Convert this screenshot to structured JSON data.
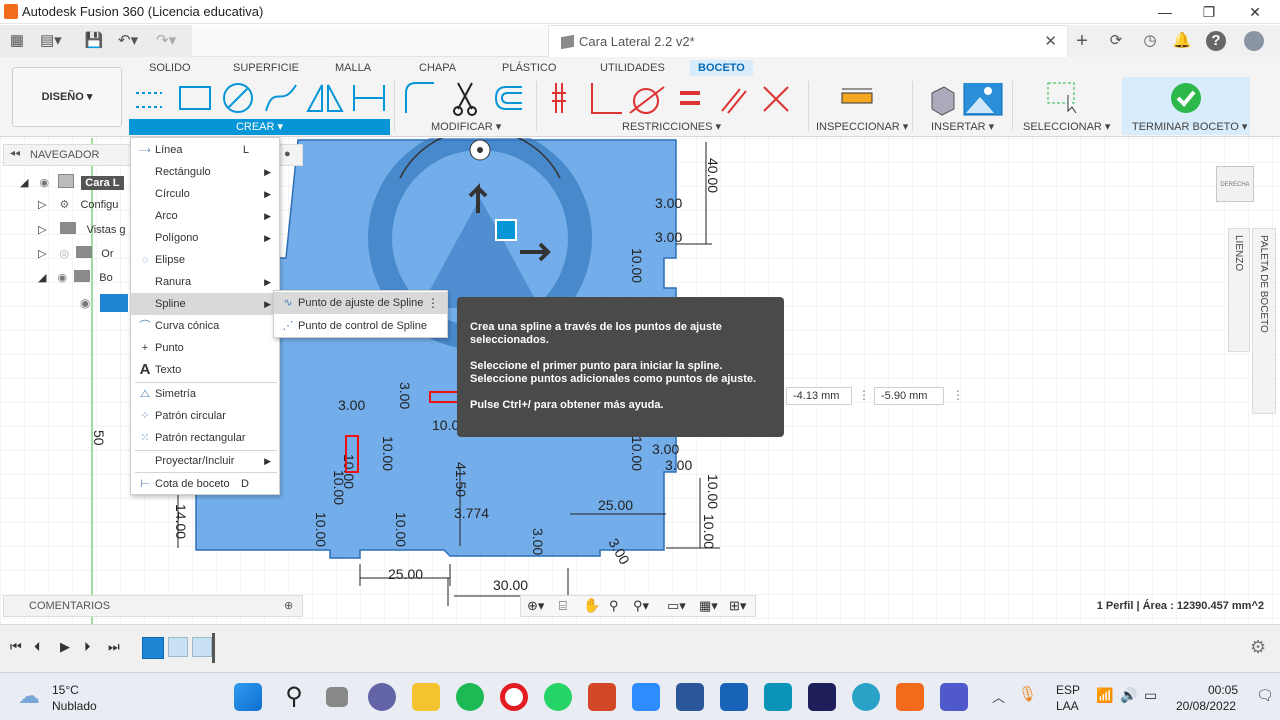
{
  "window": {
    "title": "Autodesk Fusion 360 (Licencia educativa)"
  },
  "document": {
    "tab_name": "Cara Lateral 2.2 v2*"
  },
  "ribbon": {
    "workspace": "DISEÑO",
    "tabs": [
      "SOLIDO",
      "SUPERFICIE",
      "MALLA",
      "CHAPA",
      "PLÁSTICO",
      "UTILIDADES",
      "BOCETO"
    ],
    "active_tab": "BOCETO",
    "groups": {
      "crear": "CREAR",
      "modificar": "MODIFICAR",
      "restricciones": "RESTRICCIONES",
      "inspeccionar": "INSPECCIONAR",
      "insertar": "INSERTAR",
      "seleccionar": "SELECCIONAR",
      "terminar": "TERMINAR BOCETO"
    },
    "colors": {
      "accent": "#0696d7",
      "finish_green": "#2db84b"
    }
  },
  "navigator": {
    "title": "NAVEGADOR",
    "rows": [
      "Cara L",
      "Configu",
      "Vistas g",
      "Or",
      "Bo"
    ]
  },
  "create_menu": {
    "items": [
      {
        "label": "Línea",
        "shortcut": "L",
        "icon": "line-icon"
      },
      {
        "label": "Rectángulo",
        "submenu": true,
        "icon": "rectangle-icon"
      },
      {
        "label": "Círculo",
        "submenu": true,
        "icon": "circle-icon"
      },
      {
        "label": "Arco",
        "submenu": true,
        "icon": "arc-icon"
      },
      {
        "label": "Polígono",
        "submenu": true,
        "icon": "polygon-icon"
      },
      {
        "label": "Elipse",
        "icon": "ellipse-icon"
      },
      {
        "label": "Ranura",
        "submenu": true,
        "icon": "slot-icon"
      },
      {
        "label": "Spline",
        "submenu": true,
        "icon": "spline-icon"
      },
      {
        "label": "Curva cónica",
        "icon": "conic-curve-icon"
      },
      {
        "label": "Punto",
        "icon": "point-icon"
      },
      {
        "label": "Texto",
        "icon": "text-icon"
      },
      {
        "label": "Simetría",
        "icon": "mirror-icon"
      },
      {
        "label": "Patrón circular",
        "icon": "circular-pattern-icon"
      },
      {
        "label": "Patrón rectangular",
        "icon": "rectangular-pattern-icon"
      },
      {
        "label": "Proyectar/Incluir",
        "submenu": true,
        "icon": "project-icon"
      },
      {
        "label": "Cota de boceto",
        "shortcut": "D",
        "icon": "dimension-icon"
      }
    ]
  },
  "spline_submenu": {
    "items": [
      "Punto de ajuste de Spline",
      "Punto de control de Spline"
    ]
  },
  "tooltip": {
    "line1": "Crea una spline a través de los puntos de ajuste seleccionados.",
    "line2": "Seleccione el primer punto para iniciar la spline. Seleccione puntos adicionales como puntos de ajuste.",
    "line3": "Pulse Ctrl+/ para obtener más ayuda."
  },
  "input_fields": {
    "x": "-4.13 mm",
    "y": "-5.90 mm"
  },
  "dimensions": [
    "40.00",
    "3.00",
    "3.00",
    "10.00",
    "3.00",
    "3.00",
    "10.00",
    "10.00",
    "10.00",
    "10.00",
    "10.00",
    "3.00",
    "10.00",
    "41.50",
    "3.774",
    "3.00",
    "10.00",
    "25.00",
    "10.00",
    "10.00",
    "14.00",
    "25.00",
    "30.00",
    "3.00",
    "3.00",
    "50"
  ],
  "viewcube": {
    "label": "DERECHA"
  },
  "side_panels": {
    "canvas": "LIENZO",
    "palette": "PALETA DE BOCETO"
  },
  "comments": {
    "label": "COMENTARIOS"
  },
  "status": {
    "profile": "1 Perfil | Área : 12390.457 mm^2"
  },
  "taskbar": {
    "weather_temp": "15°C",
    "weather_desc": "Nublado",
    "language": "ESP",
    "layout": "LAA",
    "time": "00:05",
    "date": "20/08/2022"
  }
}
